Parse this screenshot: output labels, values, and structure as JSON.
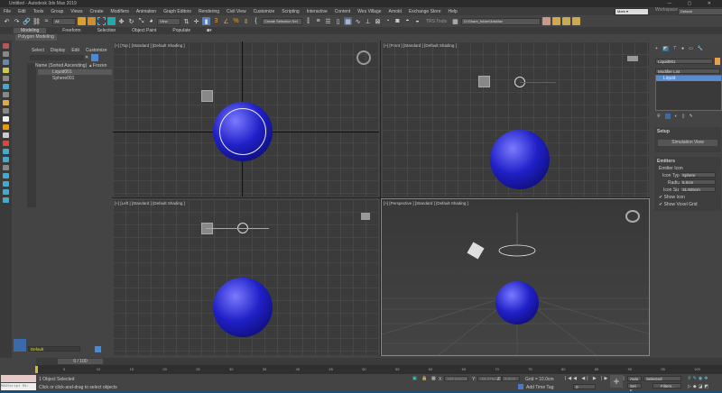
{
  "title": "Untitled - Autodesk 3ds Max 2019",
  "menu": [
    "File",
    "Edit",
    "Tools",
    "Group",
    "Views",
    "Create",
    "Modifiers",
    "Animation",
    "Graph Editors",
    "Rendering",
    "Civil View",
    "Customize",
    "Scripting",
    "Interactive",
    "Content",
    "Wes Village",
    "Arnold",
    "Exchange Store",
    "Help"
  ],
  "user": "Mark ▾",
  "workspaces_label": "Workspaces:",
  "workspace": "Default",
  "toolbar": {
    "filter": "All",
    "view": "View",
    "selection_set": "Create Selection Set",
    "tris_tools": "TRS Tools",
    "project_path": "D:\\Share_folder\\3dsMax"
  },
  "ribbon": {
    "tabs": [
      "Modeling",
      "Freeform",
      "Selection",
      "Object Paint",
      "Populate"
    ],
    "sub": "Polygon Modeling"
  },
  "explorer": {
    "menu": [
      "Select",
      "Display",
      "Edit",
      "Customize"
    ],
    "col_name": "Name (Sorted Ascending)",
    "col_frozen": "▴ Frozen",
    "items": [
      "Liquid001",
      "Sphere001"
    ],
    "layer": "Default"
  },
  "viewports": [
    "[+] [Top ] [Standard ] [Default Shading ]",
    "[+] [Front ] [Standard ] [Default Shading ]",
    "[+] [Left ] [Standard ] [Default Shading ]",
    "[+] [Perspective ] [Standard ] [Default Shading ]"
  ],
  "cmd": {
    "object_name": "Liquid001",
    "object_color": "#e8a050",
    "modifier_list": "Modifier List",
    "stack": [
      "Liquid"
    ],
    "setup": "Setup",
    "sim_view": "Simulation View",
    "emitters": "Emitters",
    "emitter_icon": "Emitter Icon",
    "icon_type_label": "Icon Type",
    "icon_type": "Sphere",
    "radius_label": "Radius",
    "radius": "5.0cm",
    "icon_size_label": "Icon Size",
    "icon_size": "31.825cm",
    "show_icon": "Show Icon",
    "show_voxel": "Show Voxel Grid"
  },
  "time": {
    "frame": "0 / 100",
    "ticks": [
      "5",
      "10",
      "15",
      "20",
      "25",
      "30",
      "35",
      "40",
      "45",
      "50",
      "55",
      "60",
      "65",
      "70",
      "75",
      "80",
      "85",
      "90",
      "95",
      "100"
    ]
  },
  "status": {
    "selected": "1 Object Selected",
    "hint": "Click or click-and-drag to select objects",
    "maxscript": "MAXScript Mi:",
    "x": "193.241cm",
    "y": "-55.275cm",
    "z": "0.0cm",
    "grid": "Grid = 10.0cm",
    "add_tag": "Add Time Tag",
    "auto": "Auto",
    "set_key": "Set K.",
    "key_mode": "Selected",
    "filters": "Filters...",
    "frame_field": "0"
  }
}
